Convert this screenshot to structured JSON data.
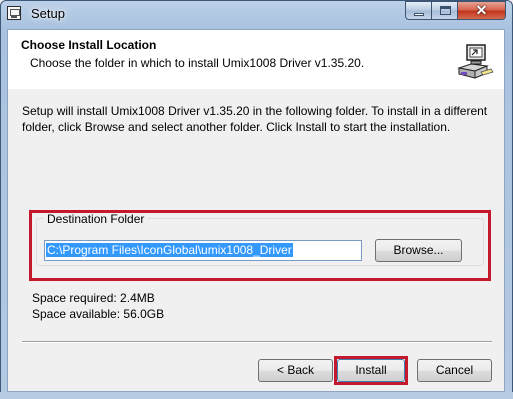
{
  "window": {
    "title": "Setup",
    "close_glyph": "✕"
  },
  "header": {
    "title": "Choose Install Location",
    "subtitle": "Choose the folder in which to install Umix1008 Driver v1.35.20."
  },
  "intro_text": "Setup will install Umix1008 Driver v1.35.20 in the following folder. To install in a different folder, click Browse and select another folder. Click Install to start the installation.",
  "destination": {
    "legend": "Destination Folder",
    "path": "C:\\Program Files\\IconGlobal\\umix1008_Driver",
    "browse_label": "Browse..."
  },
  "space": {
    "required": "Space required: 2.4MB",
    "available": "Space available: 56.0GB"
  },
  "buttons": {
    "back": "< Back",
    "install": "Install",
    "cancel": "Cancel"
  },
  "colors": {
    "highlight": "#c4182c",
    "selection": "#3399ff"
  },
  "icons": {
    "app": "setup-app-icon",
    "installer": "installer-computer-icon"
  }
}
